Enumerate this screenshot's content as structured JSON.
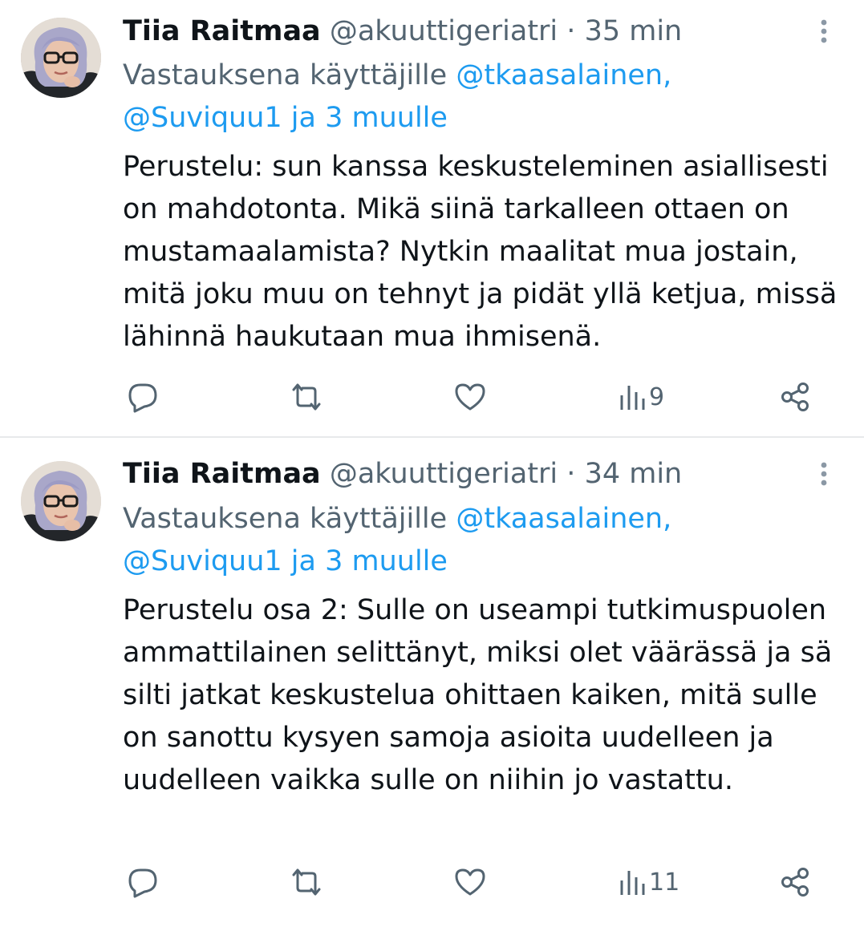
{
  "colors": {
    "text": "#0f1419",
    "secondary": "#536471",
    "link": "#1d9bf0",
    "divider": "#e7e9eb"
  },
  "icons": {
    "reply": "speech-bubble-icon",
    "retweet": "retweet-arrows-icon",
    "like": "heart-icon",
    "views": "bar-chart-icon",
    "share": "share-nodes-icon",
    "more": "vertical-dots-icon"
  },
  "tweets": [
    {
      "author": {
        "name": "Tiia Raitmaa",
        "handle": "@akuuttigeriatri"
      },
      "separator": "·",
      "time": "35 min",
      "reply_prefix": "Vastauksena käyttäjille",
      "reply_mention1": "@tkaasalainen,",
      "reply_mention2": "@Suviquu1 ja 3 muulle",
      "text": "Perustelu: sun kanssa keskusteleminen asiallisesti on mahdotonta. Mikä siinä tarkalleen ottaen on mustamaalamista? Nytkin maalitat mua jostain, mitä joku muu on tehnyt ja pidät yllä ketjua, missä lähinnä haukutaan mua ihmisenä.",
      "views": "9"
    },
    {
      "author": {
        "name": "Tiia Raitmaa",
        "handle": "@akuuttigeriatri"
      },
      "separator": "·",
      "time": "34 min",
      "reply_prefix": "Vastauksena käyttäjille",
      "reply_mention1": "@tkaasalainen,",
      "reply_mention2": "@Suviquu1 ja 3 muulle",
      "text": "Perustelu osa 2: Sulle on useampi tutkimuspuolen ammattilainen selittänyt, miksi olet väärässä ja sä silti jatkat keskustelua ohittaen kaiken, mitä sulle on sanottu kysyen samoja asioita uudelleen ja uudelleen vaikka sulle on niihin jo vastattu.",
      "views": "11"
    }
  ]
}
